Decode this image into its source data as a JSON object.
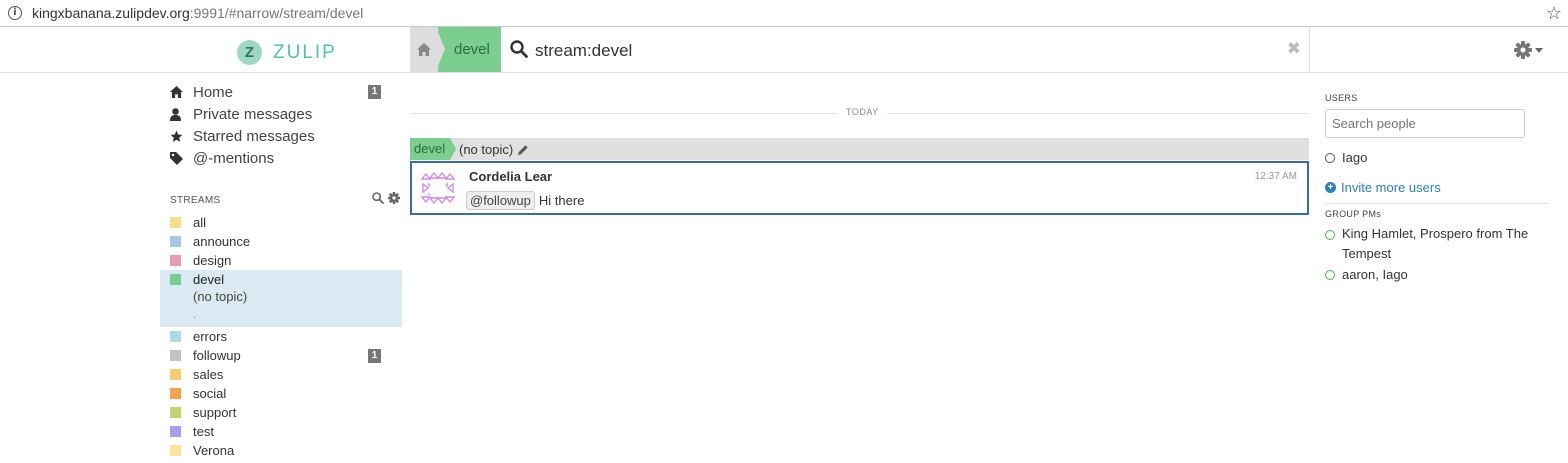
{
  "browser": {
    "url_host": "kingxbanana.zulipdev.org",
    "url_rest": ":9991/#narrow/stream/devel"
  },
  "header": {
    "logo_text": "ZULIP",
    "logo_mark": "Z",
    "narrow_stream": "devel",
    "search_query": "stream:devel"
  },
  "left_sidebar": {
    "nav": [
      {
        "label": "Home",
        "icon": "home-icon",
        "count": "1"
      },
      {
        "label": "Private messages",
        "icon": "user-icon",
        "count": ""
      },
      {
        "label": "Starred messages",
        "icon": "star-icon",
        "count": ""
      },
      {
        "label": "@-mentions",
        "icon": "tag-icon",
        "count": ""
      }
    ],
    "streams_header": "STREAMS",
    "streams": [
      {
        "name": "all",
        "color": "#f5e08a",
        "count": ""
      },
      {
        "name": "announce",
        "color": "#a6c7e5",
        "count": ""
      },
      {
        "name": "design",
        "color": "#e79ab5",
        "count": ""
      },
      {
        "name": "devel",
        "color": "#76ce90",
        "count": "",
        "active": true
      },
      {
        "name": "errors",
        "color": "#a8dde6",
        "count": ""
      },
      {
        "name": "followup",
        "color": "#c2c2c2",
        "count": "1"
      },
      {
        "name": "sales",
        "color": "#f5ce6e",
        "count": ""
      },
      {
        "name": "social",
        "color": "#f2a34b",
        "count": ""
      },
      {
        "name": "support",
        "color": "#bfd56f",
        "count": ""
      },
      {
        "name": "test",
        "color": "#a99cef",
        "count": ""
      },
      {
        "name": "Verona",
        "color": "#f9e69b",
        "count": ""
      }
    ],
    "active_topic": "(no topic)"
  },
  "center": {
    "date_label": "TODAY",
    "recipient_stream": "devel",
    "recipient_topic": "(no topic)",
    "message": {
      "sender": "Cordelia Lear",
      "time": "12:37 AM",
      "mention": "@followup",
      "text": "Hi there"
    }
  },
  "right_sidebar": {
    "users_header": "USERS",
    "search_placeholder": "Search people",
    "users": [
      {
        "name": "Iago"
      }
    ],
    "invite_label": "Invite more users",
    "group_pms_header": "GROUP PMs",
    "group_pms": [
      {
        "line1": "King Hamlet, Prospero from The",
        "line2": "Tempest"
      },
      {
        "line1": "aaron, Iago",
        "line2": ""
      }
    ]
  },
  "colors": {
    "brand": "#52c2af",
    "stream_devel": "#7bce8e",
    "selected_border": "#3a6bb0",
    "active_stream_bg": "#dbe9f2",
    "link": "#2a80c0"
  }
}
